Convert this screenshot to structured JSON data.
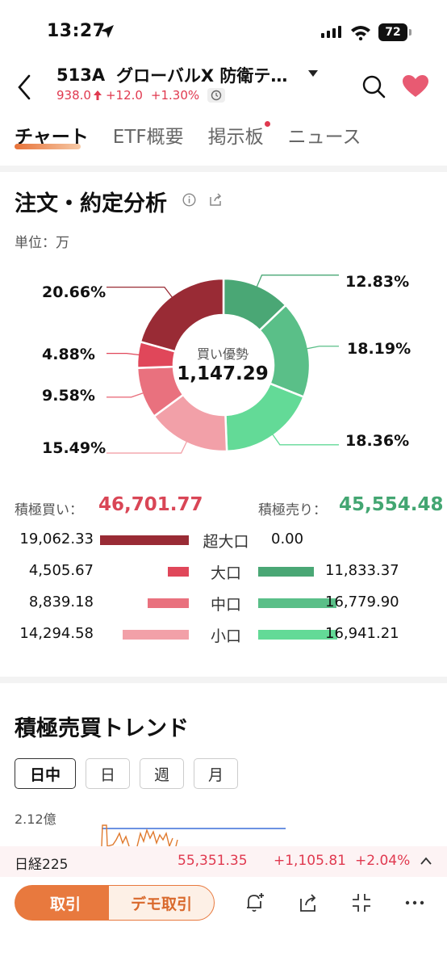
{
  "status_bar": {
    "time": "13:27",
    "battery": "72"
  },
  "header": {
    "ticker": "513A",
    "name": "グローバルX 防衛テ…",
    "price": "938.0",
    "change": "+12.0",
    "change_pct": "+1.30%"
  },
  "tabs": [
    {
      "label": "チャート",
      "active": true
    },
    {
      "label": "ETF概要"
    },
    {
      "label": "掲示板",
      "notification": true
    },
    {
      "label": "ニュース"
    }
  ],
  "order_analysis": {
    "title": "注文・約定分析",
    "unit": "単位：万",
    "center_label": "買い優勢",
    "center_value": "1,147.29",
    "left_pcts": [
      "20.66%",
      "4.88%",
      "9.58%",
      "15.49%"
    ],
    "right_pcts": [
      "12.83%",
      "18.19%",
      "18.36%"
    ],
    "buy_label": "積極買い：",
    "buy_total": "46,701.77",
    "sell_label": "積極売り：",
    "sell_total": "45,554.48",
    "rows": [
      {
        "category": "超大口",
        "buy": "19,062.33",
        "sell": "0.00"
      },
      {
        "category": "大口",
        "buy": "4,505.67",
        "sell": "11,833.37"
      },
      {
        "category": "中口",
        "buy": "8,839.18",
        "sell": "16,779.90"
      },
      {
        "category": "小口",
        "buy": "14,294.58",
        "sell": "16,941.21"
      }
    ]
  },
  "colors": {
    "buy": [
      "#992b35",
      "#e0475a",
      "#e9717e",
      "#f2a0a8"
    ],
    "sell": [
      "#4aa775",
      "#5abf88",
      "#63da97"
    ]
  },
  "chart_data": {
    "type": "pie",
    "title": "注文・約定分析",
    "center_label": "買い優勢",
    "center_value": 1147.29,
    "slices": [
      {
        "value": 12.83,
        "color": "#4aa775"
      },
      {
        "value": 18.19,
        "color": "#5abf88"
      },
      {
        "value": 18.36,
        "color": "#63da97"
      },
      {
        "value": 15.49,
        "color": "#f2a0a8"
      },
      {
        "value": 9.58,
        "color": "#e9717e"
      },
      {
        "value": 4.88,
        "color": "#e0475a"
      },
      {
        "value": 20.66,
        "color": "#992b35"
      }
    ]
  },
  "trend": {
    "title": "積極売買トレンド",
    "periods": [
      "日中",
      "日",
      "週",
      "月"
    ],
    "active_period": "日中",
    "ymax": "2.12億"
  },
  "index_ticker": {
    "name": "日経225",
    "value": "55,351.35",
    "change": "+1,105.81",
    "change_pct": "+2.04%"
  },
  "toolbar": {
    "trade_label": "取引",
    "demo_label": "デモ取引"
  }
}
